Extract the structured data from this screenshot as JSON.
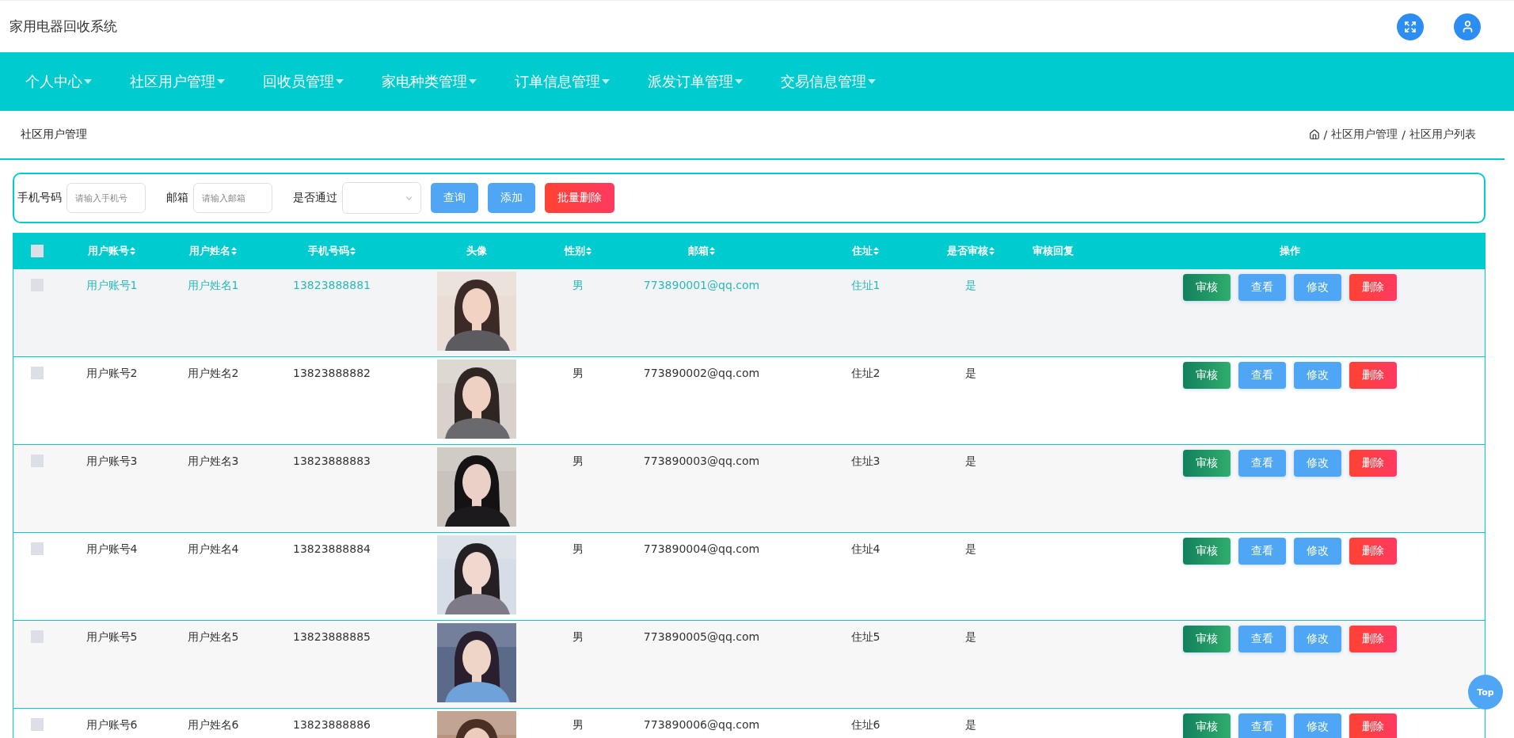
{
  "header": {
    "title": "家用电器回收系统"
  },
  "nav": [
    {
      "label": "个人中心"
    },
    {
      "label": "社区用户管理"
    },
    {
      "label": "回收员管理"
    },
    {
      "label": "家电种类管理"
    },
    {
      "label": "订单信息管理"
    },
    {
      "label": "派发订单管理"
    },
    {
      "label": "交易信息管理"
    }
  ],
  "page_title": "社区用户管理",
  "breadcrumb": {
    "separator": "/",
    "items": [
      "社区用户管理",
      "社区用户列表"
    ]
  },
  "search": {
    "fields": [
      {
        "kind": "input",
        "label": "手机号码",
        "placeholder": "请输入手机号"
      },
      {
        "kind": "input",
        "label": "邮箱",
        "placeholder": "请输入邮箱"
      },
      {
        "kind": "select",
        "label": "是否通过"
      }
    ],
    "buttons": [
      {
        "kind": "primary",
        "label": "查询"
      },
      {
        "kind": "primary",
        "label": "添加"
      },
      {
        "kind": "danger",
        "label": "批量删除"
      }
    ]
  },
  "table": {
    "select_all_checked": false,
    "columns": [
      {
        "label": "用户账号",
        "sortable": true
      },
      {
        "label": "用户姓名",
        "sortable": true
      },
      {
        "label": "手机号码",
        "sortable": true
      },
      {
        "label": "头像",
        "sortable": false
      },
      {
        "label": "性别",
        "sortable": true
      },
      {
        "label": "邮箱",
        "sortable": true
      },
      {
        "label": "住址",
        "sortable": true
      },
      {
        "label": "是否审核",
        "sortable": true
      },
      {
        "label": "审核回复",
        "sortable": false
      },
      {
        "label": "操作",
        "sortable": false
      }
    ],
    "rows": [
      {
        "highlighted": true,
        "checked": false,
        "cells": [
          "用户账号1",
          "用户姓名1",
          "13823888881",
          null,
          "男",
          "773890001@qq.com",
          "住址1",
          "是",
          ""
        ],
        "actions": [
          {
            "kind": "review",
            "label": "审核"
          },
          {
            "kind": "view",
            "label": "查看"
          },
          {
            "kind": "edit",
            "label": "修改"
          },
          {
            "kind": "delete",
            "label": "删除"
          }
        ]
      },
      {
        "highlighted": false,
        "checked": false,
        "cells": [
          "用户账号2",
          "用户姓名2",
          "13823888882",
          null,
          "男",
          "773890002@qq.com",
          "住址2",
          "是",
          ""
        ],
        "actions": [
          {
            "kind": "review",
            "label": "审核"
          },
          {
            "kind": "view",
            "label": "查看"
          },
          {
            "kind": "edit",
            "label": "修改"
          },
          {
            "kind": "delete",
            "label": "删除"
          }
        ]
      },
      {
        "highlighted": false,
        "checked": false,
        "cells": [
          "用户账号3",
          "用户姓名3",
          "13823888883",
          null,
          "男",
          "773890003@qq.com",
          "住址3",
          "是",
          ""
        ],
        "actions": [
          {
            "kind": "review",
            "label": "审核"
          },
          {
            "kind": "view",
            "label": "查看"
          },
          {
            "kind": "edit",
            "label": "修改"
          },
          {
            "kind": "delete",
            "label": "删除"
          }
        ]
      },
      {
        "highlighted": false,
        "checked": false,
        "cells": [
          "用户账号4",
          "用户姓名4",
          "13823888884",
          null,
          "男",
          "773890004@qq.com",
          "住址4",
          "是",
          ""
        ],
        "actions": [
          {
            "kind": "review",
            "label": "审核"
          },
          {
            "kind": "view",
            "label": "查看"
          },
          {
            "kind": "edit",
            "label": "修改"
          },
          {
            "kind": "delete",
            "label": "删除"
          }
        ]
      },
      {
        "highlighted": false,
        "checked": false,
        "cells": [
          "用户账号5",
          "用户姓名5",
          "13823888885",
          null,
          "男",
          "773890005@qq.com",
          "住址5",
          "是",
          ""
        ],
        "actions": [
          {
            "kind": "review",
            "label": "审核"
          },
          {
            "kind": "view",
            "label": "查看"
          },
          {
            "kind": "edit",
            "label": "修改"
          },
          {
            "kind": "delete",
            "label": "删除"
          }
        ]
      },
      {
        "highlighted": false,
        "checked": false,
        "cells": [
          "用户账号6",
          "用户姓名6",
          "13823888886",
          null,
          "男",
          "773890006@qq.com",
          "住址6",
          "是",
          ""
        ],
        "actions": [
          {
            "kind": "review",
            "label": "审核"
          },
          {
            "kind": "view",
            "label": "查看"
          },
          {
            "kind": "edit",
            "label": "修改"
          },
          {
            "kind": "delete",
            "label": "删除"
          }
        ]
      }
    ]
  },
  "back_to_top": {
    "label": "Top"
  }
}
